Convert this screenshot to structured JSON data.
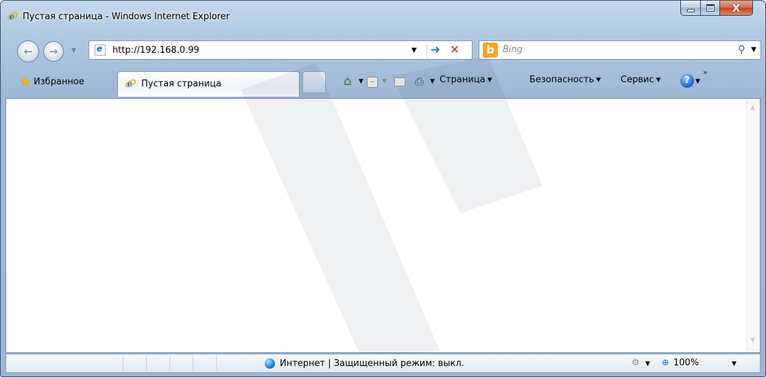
{
  "window": {
    "title": "Пустая страница - Windows Internet Explorer",
    "caption": {
      "minimize": "minimize-icon",
      "maximize": "maximize-icon",
      "close": "X"
    }
  },
  "navigation": {
    "address": "http://192.168.0.99",
    "search_placeholder": "Bing",
    "bing_logo": "b"
  },
  "toolbar": {
    "favorites_label": "Избранное",
    "tab_title": "Пустая страница",
    "menus": {
      "page": "Страница",
      "security": "Безопасность",
      "tools": "Сервис"
    },
    "help": "?",
    "more": "»"
  },
  "status": {
    "zone": "Интернет | Защищенный режим: выкл.",
    "zoom": "100%"
  },
  "colors": {
    "frame": "#a8c1dd",
    "close_button": "#c4401f",
    "link_blue": "#1b64c4"
  }
}
